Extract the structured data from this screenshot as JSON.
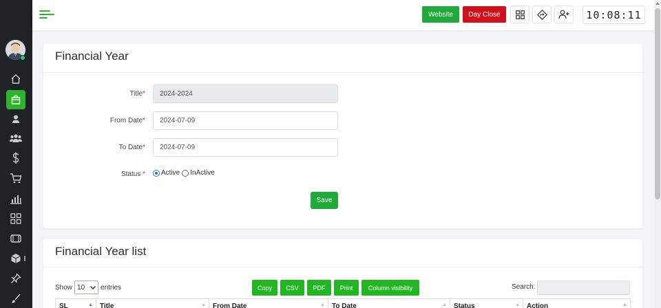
{
  "topbar": {
    "website_label": "Website",
    "day_close_label": "Day Close",
    "clock": "10:08:11"
  },
  "sidebar": {
    "icons": [
      "home-icon",
      "shopping-bag-icon",
      "user-icon",
      "users-icon",
      "dollar-icon",
      "cart-icon",
      "bar-chart-icon",
      "grid-icon",
      "film-icon",
      "box-icon",
      "pin-icon",
      "brush-icon"
    ],
    "active": "shopping-bag-icon"
  },
  "form": {
    "title": "Financial Year",
    "fields": {
      "title_label": "Title",
      "title_value": "2024-2024",
      "from_label": "From Date",
      "from_value": "2024-07-09",
      "to_label": "To Date",
      "to_value": "2024-07-09",
      "status_label": "Status "
    },
    "required_mark": "*",
    "status_options": [
      "Active",
      "InActive"
    ],
    "status_selected": "Active",
    "save_label": "Save"
  },
  "list": {
    "title": "Financial Year list",
    "show_label": "Show",
    "entries_value": "10",
    "entries_label": "entries",
    "buttons": [
      "Copy",
      "CSV",
      "PDF",
      "Print",
      "Column visibility"
    ],
    "search_label": "Search:",
    "columns": [
      "SL",
      "Title",
      "From Date",
      "To Date",
      "Status",
      "Action"
    ]
  },
  "colors": {
    "accent_green": "#1faa3a",
    "danger_red": "#d0101a",
    "sidebar_bg": "#1e2226"
  }
}
